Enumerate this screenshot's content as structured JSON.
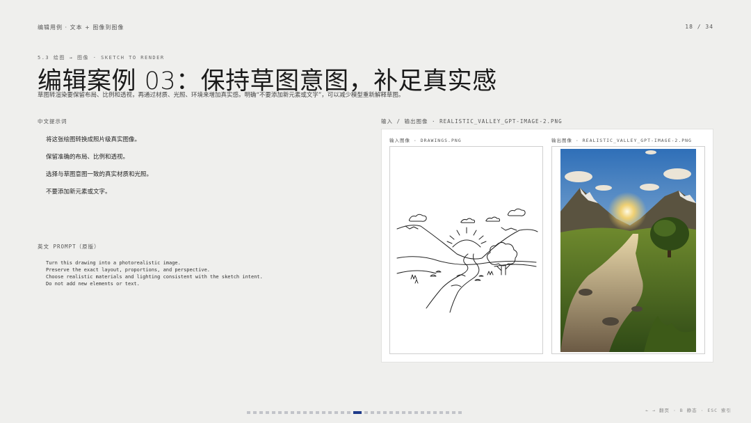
{
  "header": {
    "breadcrumb": "编辑用例 · 文本 + 图像到图像",
    "page_counter": "18 / 34"
  },
  "section": {
    "label": "5.3 绘图 → 图像 · SKETCH TO RENDER",
    "title": "编辑案例 03：保持草图意图，补足真实感",
    "subtitle": "草图转渲染要保留布局、比例和透视，再通过材质、光照、环境来增加真实感。明确“不要添加新元素或文字”，可以减少模型重新解释草图。"
  },
  "left": {
    "cn_heading": "中文提示词",
    "cn_prompt": [
      "将这张绘图转换成照片级真实图像。",
      "保留准确的布局、比例和透视。",
      "选择与草图意图一致的真实材质和光照。",
      "不要添加新元素或文字。"
    ],
    "en_heading": "英文 PROMPT（原版）",
    "en_prompt": "Turn this drawing into a photorealistic image.\nPreserve the exact layout, proportions, and perspective.\nChoose realistic materials and lighting consistent with the sketch intent.\nDo not add new elements or text."
  },
  "right": {
    "card_heading": "输入 / 输出图像 · REALISTIC_VALLEY_GPT-IMAGE-2.PNG",
    "input_label": "输入图像 · DRAWINGS.PNG",
    "output_label": "输出图像 · REALISTIC_VALLEY_GPT-IMAGE-2.PNG"
  },
  "footer": {
    "pager_total": 34,
    "pager_current": 18,
    "key_hint": "← → 翻页 · B 静态 · ESC 索引"
  },
  "colors": {
    "background": "#efefed",
    "accent": "#1e3a8a",
    "pager_inactive": "#c2c4c9"
  }
}
